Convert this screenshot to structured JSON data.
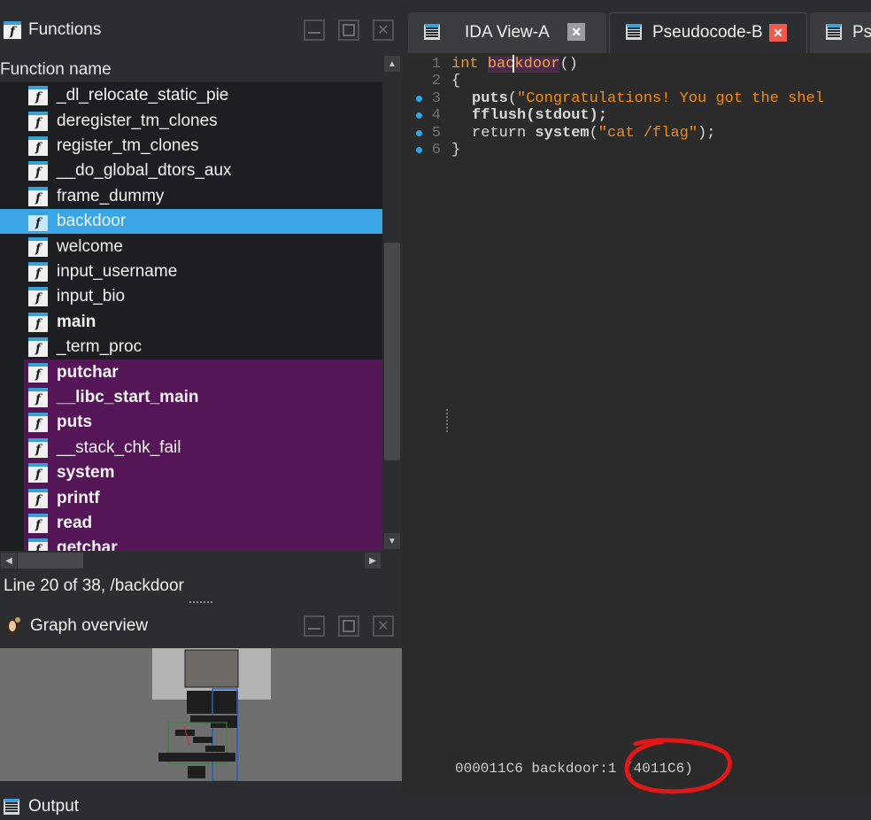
{
  "functions_panel": {
    "title": "Functions",
    "column_header": "Function name",
    "items": [
      {
        "name": "_dl_relocate_static_pie",
        "style": "normal"
      },
      {
        "name": "deregister_tm_clones",
        "style": "normal"
      },
      {
        "name": "register_tm_clones",
        "style": "normal"
      },
      {
        "name": "__do_global_dtors_aux",
        "style": "normal"
      },
      {
        "name": "frame_dummy",
        "style": "normal"
      },
      {
        "name": "backdoor",
        "style": "selected"
      },
      {
        "name": "welcome",
        "style": "normal"
      },
      {
        "name": "input_username",
        "style": "normal"
      },
      {
        "name": "input_bio",
        "style": "normal"
      },
      {
        "name": "main",
        "style": "bold"
      },
      {
        "name": "_term_proc",
        "style": "normal"
      },
      {
        "name": "putchar",
        "style": "import"
      },
      {
        "name": "__libc_start_main",
        "style": "import"
      },
      {
        "name": "puts",
        "style": "import"
      },
      {
        "name": "__stack_chk_fail",
        "style": "import"
      },
      {
        "name": "system",
        "style": "import"
      },
      {
        "name": "printf",
        "style": "import"
      },
      {
        "name": "read",
        "style": "import"
      },
      {
        "name": "getchar",
        "style": "import"
      }
    ],
    "status": "Line 20 of 38, /backdoor"
  },
  "graph_overview": {
    "title": "Graph overview"
  },
  "output": {
    "title": "Output"
  },
  "tabs": [
    {
      "label": "IDA View-A",
      "active": false
    },
    {
      "label": "Pseudocode-B",
      "active": true
    },
    {
      "label": "Ps",
      "active": false
    }
  ],
  "code": {
    "line_numbers": [
      "1",
      "2",
      "3",
      "4",
      "5",
      "6"
    ],
    "line1": {
      "kw": "int",
      "fn": "backdoor",
      "rest": "()"
    },
    "line2": "{",
    "line3": {
      "fn": "puts",
      "open": "(",
      "str": "\"Congratulations! You got the shel"
    },
    "line4": "fflush(stdout);",
    "line5": {
      "kw": "return",
      "fn": "system",
      "open": "(",
      "str": "\"cat /flag\"",
      "close": ");"
    },
    "line6": "}",
    "status": "000011C6 backdoor:1 (4011C6)"
  },
  "colors": {
    "selected_row": "#3aa6e6",
    "import_row": "#541657",
    "annotation": "#e01818"
  },
  "icons": [
    "function-icon",
    "graph-icon",
    "list-icon",
    "close-icon",
    "restore-icon",
    "minimize-icon"
  ]
}
